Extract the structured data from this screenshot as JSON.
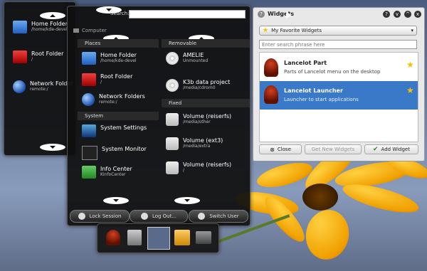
{
  "launcher": {
    "search_label": "Search:",
    "search_value": "",
    "computer_label": "Computer",
    "places_header": "Places",
    "removable_header": "Removable",
    "system_header": "System",
    "fixed_header": "Fixed",
    "places": [
      {
        "title": "Home Folder",
        "sub": "/home/kde-devel",
        "icon": "folder-home-icon"
      },
      {
        "title": "Root Folder",
        "sub": "/",
        "icon": "folder-red-icon"
      },
      {
        "title": "Network Folders",
        "sub": "remote:/",
        "icon": "network-globe-icon"
      }
    ],
    "removable": [
      {
        "title": "AMELIE",
        "sub": "Unmounted",
        "icon": "cdrom-icon"
      },
      {
        "title": "K3b data project",
        "sub": "/media/cdrom0",
        "icon": "cdrom-icon"
      }
    ],
    "system": [
      {
        "title": "System Settings",
        "sub": "",
        "icon": "system-settings-icon"
      },
      {
        "title": "System Monitor",
        "sub": "",
        "icon": "system-monitor-icon"
      },
      {
        "title": "Info Center",
        "sub": "KInfoCenter",
        "icon": "info-center-icon"
      }
    ],
    "fixed": [
      {
        "title": "Volume (reiserfs)",
        "sub": "/media/other",
        "icon": "hard-drive-icon"
      },
      {
        "title": "Volume (ext3)",
        "sub": "/media/extra",
        "icon": "hard-drive-icon"
      },
      {
        "title": "Volume (reiserfs)",
        "sub": "/",
        "icon": "hard-drive-icon"
      }
    ],
    "lock_label": "Lock Session",
    "logout_label": "Log Out...",
    "switch_label": "Switch User"
  },
  "left_panel": {
    "items": [
      {
        "title": "Home Folder",
        "sub": "/home/kde-devel"
      },
      {
        "title": "Root Folder",
        "sub": "/"
      },
      {
        "title": "Network Folder",
        "sub": "remote:/"
      }
    ]
  },
  "widgets": {
    "title": "Widgets",
    "help": "?",
    "category": "My Favorite Widgets",
    "search_placeholder": "Enter search phrase here",
    "list": [
      {
        "title": "Lancelot Part",
        "desc": "Parts of Lancelot menu on the desktop",
        "selected": false
      },
      {
        "title": "Lancelot Launcher",
        "desc": "Launcher to start applications",
        "selected": true
      }
    ],
    "close_label": "Close",
    "get_new_label": "Get New Widgets",
    "add_label": "Add Widget"
  },
  "colors": {
    "selection": "#3a78c8",
    "accent_star": "#f2c200"
  }
}
